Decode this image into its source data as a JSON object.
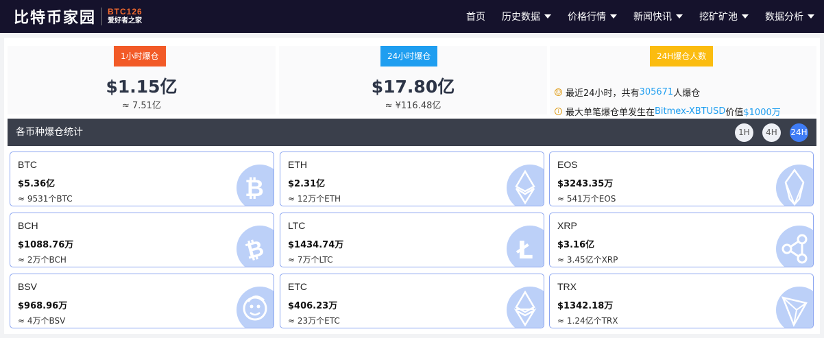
{
  "header": {
    "logo_cn": "比特币家园",
    "logo_en": "BTC126",
    "logo_slogan": "爱好者之家",
    "nav": [
      {
        "label": "首页",
        "dropdown": false
      },
      {
        "label": "历史数据",
        "dropdown": true
      },
      {
        "label": "价格行情",
        "dropdown": true
      },
      {
        "label": "新闻快讯",
        "dropdown": true
      },
      {
        "label": "挖矿矿池",
        "dropdown": true
      },
      {
        "label": "数据分析",
        "dropdown": true
      }
    ]
  },
  "stats": {
    "hour1": {
      "tag": "1小时爆仓",
      "value": "$1.15亿",
      "sub": "≈ 7.51亿"
    },
    "hour24": {
      "tag": "24小时爆仓",
      "value": "$17.80亿",
      "sub": "≈ ¥116.48亿"
    },
    "people": {
      "tag": "24H爆仓人数",
      "line1_pre": "最近24小时，共有",
      "line1_num": "305671",
      "line1_post": "人爆仓",
      "line2_pre": "最大单笔爆仓单发生在",
      "line2_pair": "Bitmex-XBTUSD",
      "line2_mid": "价值",
      "line2_amount": "$1000万"
    }
  },
  "section": {
    "title": "各币种爆仓统计",
    "tabs": [
      "1H",
      "4H",
      "24H"
    ],
    "active_tab": "24H"
  },
  "coins": [
    {
      "name": "BTC",
      "value": "$5.36亿",
      "sub": "≈ 9531个BTC",
      "icon": "bitcoin-icon"
    },
    {
      "name": "ETH",
      "value": "$2.31亿",
      "sub": "≈ 12万个ETH",
      "icon": "ethereum-icon"
    },
    {
      "name": "EOS",
      "value": "$3243.35万",
      "sub": "≈ 541万个EOS",
      "icon": "eos-icon"
    },
    {
      "name": "BCH",
      "value": "$1088.76万",
      "sub": "≈ 2万个BCH",
      "icon": "bitcoin-cash-icon"
    },
    {
      "name": "LTC",
      "value": "$1434.74万",
      "sub": "≈ 7万个LTC",
      "icon": "litecoin-icon"
    },
    {
      "name": "XRP",
      "value": "$3.16亿",
      "sub": "≈ 3.45亿个XRP",
      "icon": "ripple-icon"
    },
    {
      "name": "BSV",
      "value": "$968.96万",
      "sub": "≈ 4万个BSV",
      "icon": "bsv-icon"
    },
    {
      "name": "ETC",
      "value": "$406.23万",
      "sub": "≈ 23万个ETC",
      "icon": "ethereum-classic-icon"
    },
    {
      "name": "TRX",
      "value": "$1342.18万",
      "sub": "≈ 1.24亿个TRX",
      "icon": "tron-icon"
    }
  ],
  "colors": {
    "header_bg": "#15122c",
    "tag_red": "#f25a27",
    "tag_blue": "#1f9ef0",
    "tag_yellow": "#fbbc10",
    "card_border": "#8aa4f0",
    "coin_badge": "#bcd0f8",
    "active_tab": "#3f7cf5"
  }
}
